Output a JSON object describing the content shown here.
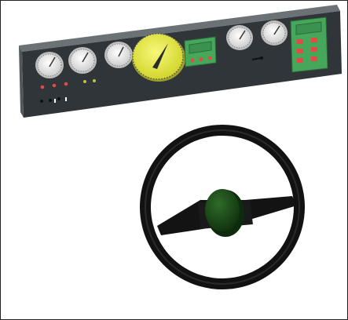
{
  "scene": {
    "subject": "vehicle-dashboard-and-steering-wheel",
    "colors": {
      "panel_face": "#2e3437",
      "panel_top": "#5d6569",
      "gauge_face": "#f2f2ef",
      "gauge_bezel": "#c7c7c7",
      "speedometer": "#e9ec3b",
      "display_green": "#44aa5b",
      "display_screen": "#3f9a53",
      "indicator_red": "#e34b45",
      "indicator_amber": "#bfc23d",
      "wheel_rim": "#141414",
      "wheel_hub": "#1b4619"
    },
    "controls": {
      "left_gauges": 3,
      "right_gauges": 2,
      "keypad_buttons": 6,
      "display_buttons": 3
    }
  }
}
